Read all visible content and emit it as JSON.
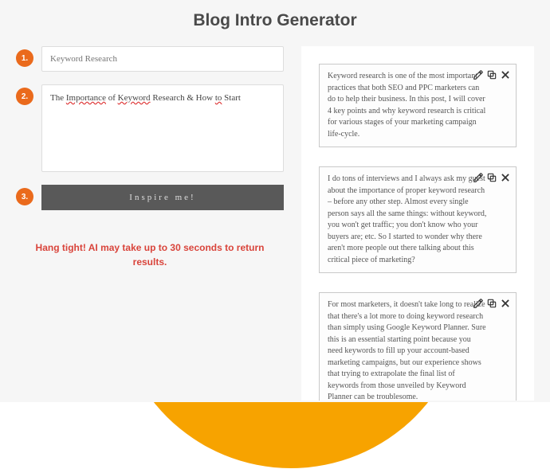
{
  "title": "Blog Intro Generator",
  "badges": {
    "one": "1.",
    "two": "2.",
    "three": "3."
  },
  "form": {
    "keyword_placeholder": "Keyword Research",
    "topic_segments": [
      {
        "t": "The "
      },
      {
        "t": "Importance",
        "u": true
      },
      {
        "t": " of "
      },
      {
        "t": "Keyword",
        "u": true
      },
      {
        "t": " Research & How "
      },
      {
        "t": "to",
        "u": true
      },
      {
        "t": " Start"
      }
    ],
    "button_label": "Inspire me!",
    "wait_note": "Hang tight! AI may take up to 30 seconds to return results."
  },
  "results": [
    {
      "text": "Keyword research is one of the most important practices that both SEO and PPC marketers can do to help their business. In this post, I will cover 4 key points and why keyword research is critical for various stages of your marketing campaign life-cycle."
    },
    {
      "text": "I do tons of interviews and I always ask my guest about the importance of proper keyword research – before any other step. Almost every single person says all the same things: without keyword, you won't get traffic; you don't know who your buyers are; etc. So I started to wonder why there aren't more people out there talking about this critical piece of marketing?"
    },
    {
      "text": "For most marketers, it doesn't take long to realize that there's a lot more to doing keyword research than simply using Google Keyword Planner. Sure this is an essential starting point because you need keywords to fill up your account-based marketing campaigns, but our experience shows that trying to extrapolate the final list of keywords from those unveiled by Keyword Planner can be troublesome."
    }
  ]
}
